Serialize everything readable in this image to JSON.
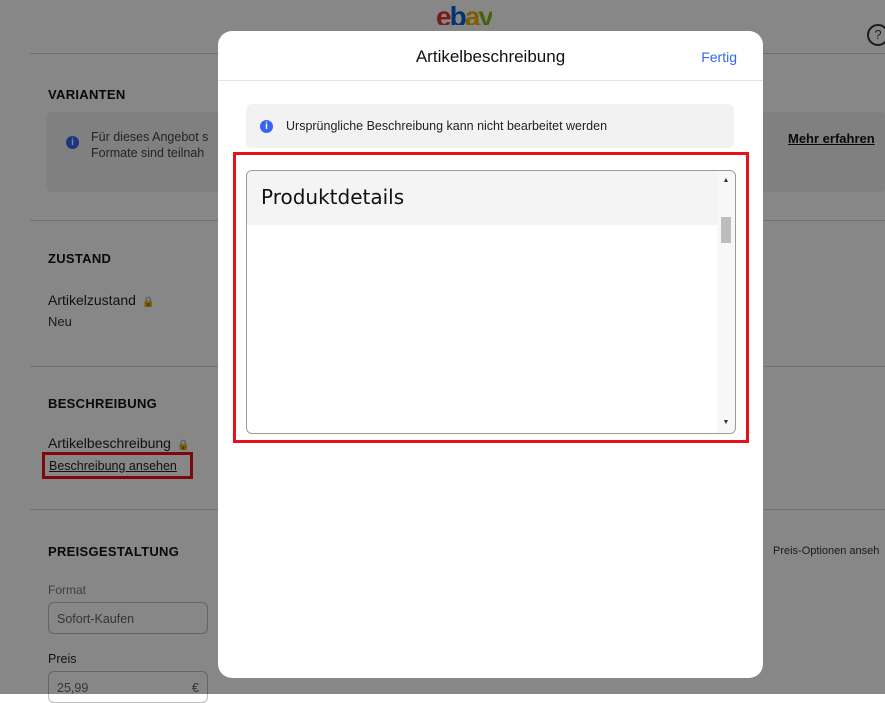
{
  "header": {
    "logo_letters": [
      "e",
      "b",
      "a",
      "y"
    ],
    "help_label": "?"
  },
  "background": {
    "variants_title": "VARIANTEN",
    "variants_info_line1": "Für dieses Angebot s",
    "variants_info_line2": "Formate sind teilnah",
    "learn_more": "Mehr erfahren",
    "condition_title": "ZUSTAND",
    "condition_label": "Artikelzustand",
    "condition_value": "Neu",
    "description_title": "BESCHREIBUNG",
    "description_label": "Artikelbeschreibung",
    "view_description_link": "Beschreibung ansehen",
    "pricing_title": "PREISGESTALTUNG",
    "price_options_link": "Preis-Optionen anseh",
    "format_label": "Format",
    "format_value": "Sofort-Kaufen",
    "price_label": "Preis",
    "price_value": "25,99",
    "currency": "€"
  },
  "modal": {
    "title": "Artikelbeschreibung",
    "done_label": "Fertig",
    "notice_text": "Ursprüngliche Beschreibung kann nicht bearbeitet werden",
    "content_heading": "Produktdetails"
  },
  "colors": {
    "accent_blue": "#3665f3",
    "highlight_red": "#e8101a",
    "logo_red": "#e53238",
    "logo_blue": "#0064d2",
    "logo_yellow": "#f5af02",
    "logo_green": "#86b817"
  }
}
